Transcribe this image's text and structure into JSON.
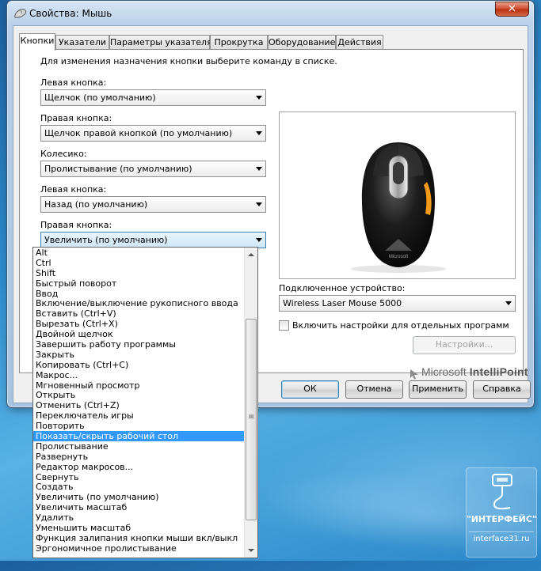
{
  "window": {
    "title": "Свойства: Мышь",
    "close_glyph": "✕"
  },
  "tabs": [
    {
      "label": "Кнопки",
      "active": true
    },
    {
      "label": "Указатели"
    },
    {
      "label": "Параметры указателя"
    },
    {
      "label": "Прокрутка"
    },
    {
      "label": "Оборудование"
    },
    {
      "label": "Действия"
    }
  ],
  "panel": {
    "instruction": "Для изменения назначения кнопки выберите команду в списке.",
    "fields": [
      {
        "label": "Левая кнопка:",
        "value": "Щелчок (по умолчанию)"
      },
      {
        "label": "Правая кнопка:",
        "value": "Щелчок правой кнопкой (по умолчанию)"
      },
      {
        "label": "Колесико:",
        "value": "Пролистывание (по умолчанию)"
      },
      {
        "label": "Левая кнопка:",
        "value": "Назад (по умолчанию)"
      },
      {
        "label": "Правая кнопка:",
        "value": "Увеличить (по умолчанию)"
      }
    ],
    "device_label": "Подключенное устройство:",
    "device_value": "Wireless Laser Mouse 5000",
    "per_program_checkbox": "Включить настройки для отдельных программ",
    "per_program_checked": false,
    "settings_button": "Настройки...",
    "logo_brand": "Microsoft",
    "logo_product": "IntelliPoint"
  },
  "buttons": {
    "ok": "ОК",
    "cancel": "Отмена",
    "apply": "Применить",
    "help": "Справка"
  },
  "dropdown": {
    "selected_index": 19,
    "items": [
      "Alt",
      "Ctrl",
      "Shift",
      "Быстрый поворот",
      "Ввод",
      "Включение/выключение рукописного ввода",
      "Вставить (Ctrl+V)",
      "Вырезать (Ctrl+X)",
      "Двойной щелчок",
      "Завершить работу программы",
      "Закрыть",
      "Копировать (Ctrl+C)",
      "Макрос...",
      "Мгновенный просмотр",
      "Открыть",
      "Отменить (Ctrl+Z)",
      "Переключатель игры",
      "Повторить",
      "Показать/скрыть рабочий стол",
      "Пролистывание",
      "Развернуть",
      "Редактор макросов...",
      "Свернуть",
      "Создать",
      "Увеличить (по умолчанию)",
      "Увеличить масштаб",
      "Удалить",
      "Уменьшить масштаб",
      "Функция залипания кнопки мыши вкл/выкл",
      "Эргономичное пролистывание"
    ]
  },
  "watermark": {
    "name": "\"ИНТЕРФЕЙС\"",
    "url": "interface31.ru"
  },
  "colors": {
    "selection": "#3399ff",
    "desktop": "#2f8fd0"
  }
}
